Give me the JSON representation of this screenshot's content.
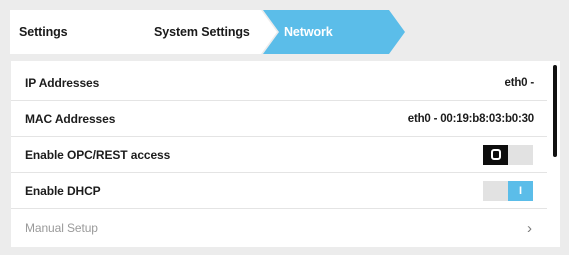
{
  "breadcrumb": {
    "items": [
      {
        "label": "Settings"
      },
      {
        "label": "System Settings"
      },
      {
        "label": "Network"
      }
    ],
    "active_color": "#5bbde9",
    "inactive_color": "#ffffff"
  },
  "settings": {
    "ip_addresses": {
      "label": "IP Addresses",
      "value": "eth0 -"
    },
    "mac_addresses": {
      "label": "MAC Addresses",
      "value": "eth0 - 00:19:b8:03:b0:30"
    },
    "opc_rest": {
      "label": "Enable OPC/REST access",
      "state": "off",
      "knob_text": "O"
    },
    "dhcp": {
      "label": "Enable DHCP",
      "state": "on",
      "knob_text": "I"
    },
    "manual_setup": {
      "label": "Manual Setup",
      "icon": "chevron-right-icon",
      "chevron": "›"
    }
  },
  "colors": {
    "accent": "#5bbde9",
    "toggle_off": "#0d0d0d",
    "disabled_text": "#9a9a9a"
  }
}
